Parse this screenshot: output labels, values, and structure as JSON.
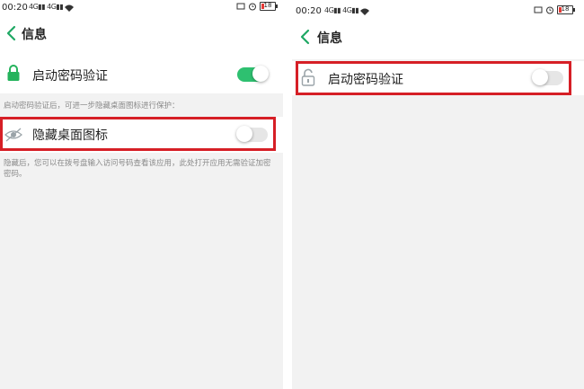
{
  "left": {
    "status": {
      "time": "00:20",
      "signal": "ᵀᵀ",
      "battery": "18",
      "battery_level": 0.18
    },
    "header": {
      "title": "信息"
    },
    "lock_row": {
      "label": "启动密码验证",
      "toggle_on": true
    },
    "hint_text": "启动密码验证后，可进一步隐藏桌面图标进行保护：",
    "hide_row": {
      "label": "隐藏桌面图标",
      "toggle_on": false
    },
    "footer_note": "隐藏后，您可以在拨号盘输入访问号码查看该应用，此处打开应用无需验证加密密码。"
  },
  "right": {
    "status": {
      "time": "00:20",
      "battery": "18",
      "battery_level": 0.18
    },
    "header": {
      "title": "信息"
    },
    "lock_row": {
      "label": "启动密码验证",
      "toggle_on": false
    }
  },
  "colors": {
    "toggle_on": "#2ec070",
    "highlight": "#d61f26",
    "back_arrow": "#1fa864",
    "lock_green": "#24b35c"
  }
}
